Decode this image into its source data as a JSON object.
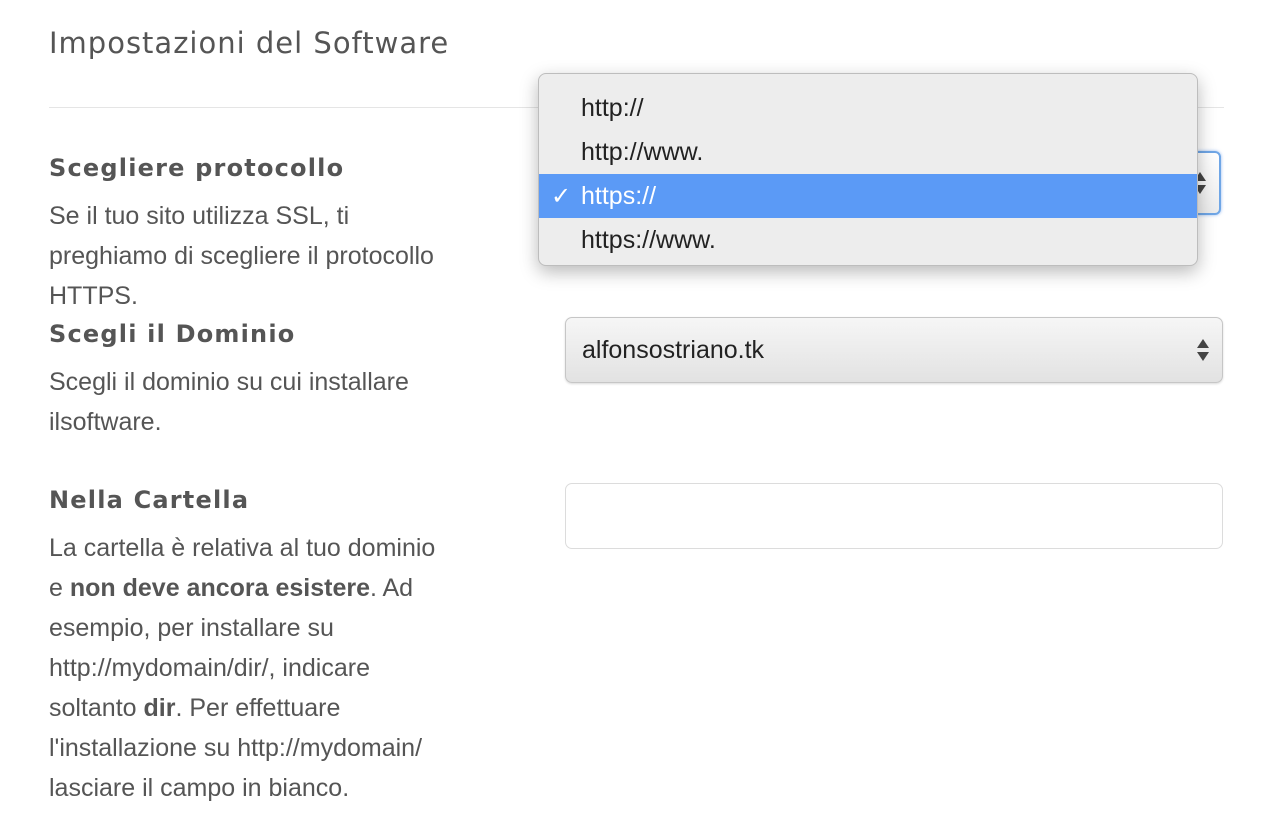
{
  "page": {
    "title": "Impostazioni del Software"
  },
  "protocol": {
    "label": "Scegliere protocollo",
    "desc_lines": [
      "Se il tuo sito utilizza SSL, ti",
      "preghiamo di scegliere il protocollo",
      "HTTPS."
    ],
    "options": [
      "http://",
      "http://www.",
      "https://",
      "https://www."
    ],
    "selected": "https://",
    "check_glyph": "✓",
    "highlight_color": "#5b9af6"
  },
  "domain": {
    "label": "Scegli il Dominio",
    "desc_lines": [
      "Scegli il dominio su cui installare",
      "ilsoftware."
    ],
    "selected": "alfonsostriano.tk"
  },
  "folder": {
    "label": "Nella Cartella",
    "desc": {
      "l1": "La cartella è relativa al tuo dominio",
      "l2_pre": "e ",
      "l2_bold": "non deve ancora esistere",
      "l2_post": ". Ad",
      "l3": "esempio, per installare su",
      "l4": "http://mydomain/dir/, indicare",
      "l5_pre": "soltanto ",
      "l5_bold": "dir",
      "l5_post": ". Per effettuare",
      "l6": "l'installazione su http://mydomain/",
      "l7": "lasciare il campo in bianco."
    },
    "value": "",
    "placeholder": ""
  }
}
